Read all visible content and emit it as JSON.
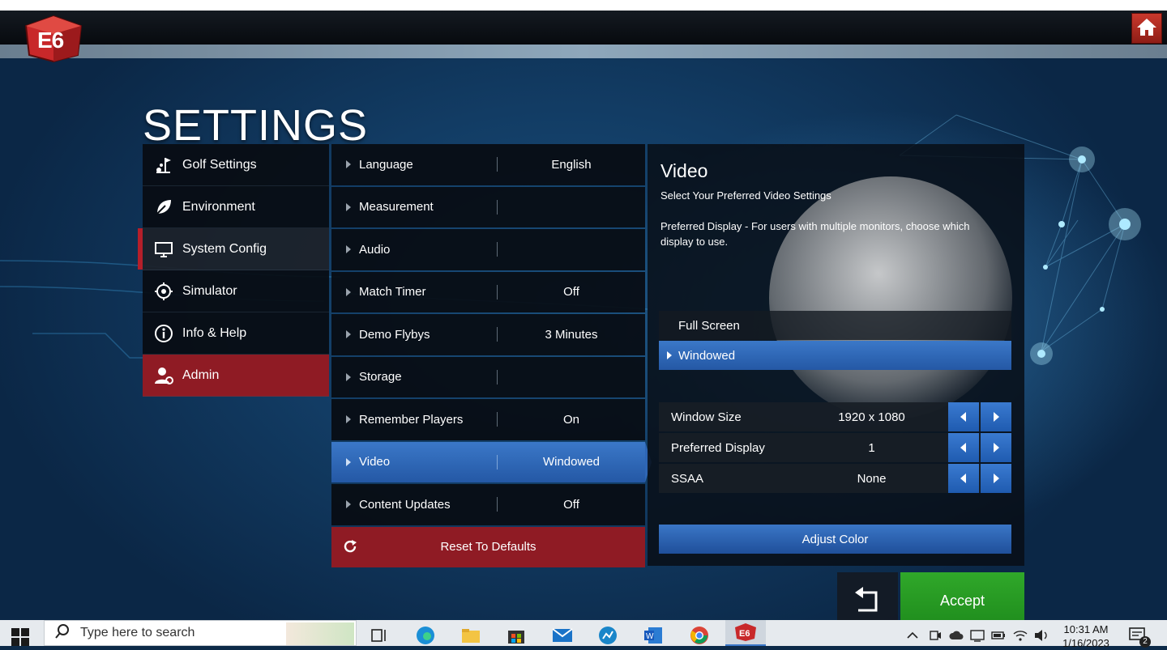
{
  "app": {
    "logo_text": "E6",
    "home_icon": "home-icon"
  },
  "page_title": "SETTINGS",
  "categories": [
    {
      "label": "Golf Settings",
      "icon": "golf-flag-icon"
    },
    {
      "label": "Environment",
      "icon": "leaf-icon"
    },
    {
      "label": "System Config",
      "icon": "monitor-icon",
      "selected": true
    },
    {
      "label": "Simulator",
      "icon": "target-icon"
    },
    {
      "label": "Info & Help",
      "icon": "info-icon"
    },
    {
      "label": "Admin",
      "icon": "admin-user-icon"
    }
  ],
  "options": [
    {
      "label": "Language",
      "value": "English"
    },
    {
      "label": "Measurement",
      "value": ""
    },
    {
      "label": "Audio",
      "value": ""
    },
    {
      "label": "Match Timer",
      "value": "Off"
    },
    {
      "label": "Demo Flybys",
      "value": "3 Minutes"
    },
    {
      "label": "Storage",
      "value": ""
    },
    {
      "label": "Remember Players",
      "value": "On"
    },
    {
      "label": "Video",
      "value": "Windowed",
      "active": true
    },
    {
      "label": "Content Updates",
      "value": "Off"
    }
  ],
  "reset_label": "Reset To Defaults",
  "detail": {
    "title": "Video",
    "subtitle": "Select Your Preferred Video Settings",
    "description": "Preferred Display - For users with multiple monitors, choose which display to use.",
    "modes": {
      "full": "Full Screen",
      "windowed": "Windowed",
      "selected": "windowed"
    },
    "rows": [
      {
        "label": "Window Size",
        "value": "1920 x 1080"
      },
      {
        "label": "Preferred Display",
        "value": "1"
      },
      {
        "label": "SSAA",
        "value": "None"
      }
    ],
    "adjust_color": "Adjust Color"
  },
  "accept_label": "Accept",
  "back_icon": "back-arrow-icon",
  "taskbar": {
    "search_placeholder": "Type here to search",
    "time": "10:31 AM",
    "date": "1/16/2023",
    "notification_count": "2"
  },
  "colors": {
    "accent_blue": "#2e66b5",
    "admin_red": "#8f1b24",
    "accept_green": "#25981f"
  }
}
